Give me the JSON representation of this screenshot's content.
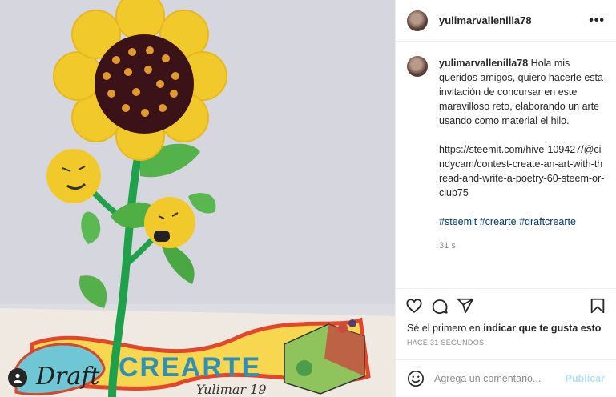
{
  "post": {
    "username": "yulimarvallenilla78",
    "caption_username": "yulimarvallenilla78",
    "caption_text": "Hola mis queridos amigos, quiero hacerle esta invitación de concursar en este maravilloso reto, elaborando un arte usando como material el hilo.",
    "caption_link": "https://steemit.com/hive-109427/@cindycam/contest-create-an-art-with-thread-and-write-a-poetry-60-steem-or-club75",
    "hashtags": [
      "#steemit",
      "#crearte",
      "#draftcrearte"
    ],
    "caption_time": "31 s",
    "likes_prefix": "Sé el primero en ",
    "likes_action": "indicar que te gusta esto",
    "posted_ago": "HACE 31 SEGUNDOS",
    "comment_placeholder": "Agrega un comentario...",
    "publish_label": "Publicar"
  },
  "media": {
    "banner_text": "CREARTE",
    "banner_script": "Draft",
    "banner_signature": "Yulimar 19"
  },
  "icons": [
    "more-options-icon",
    "heart-icon",
    "comment-icon",
    "share-icon",
    "bookmark-icon",
    "emoji-icon",
    "user-tag-icon"
  ],
  "colors": {
    "accent": "#0095f6",
    "publish_disabled": "#b2dffc",
    "link": "#00376b"
  }
}
